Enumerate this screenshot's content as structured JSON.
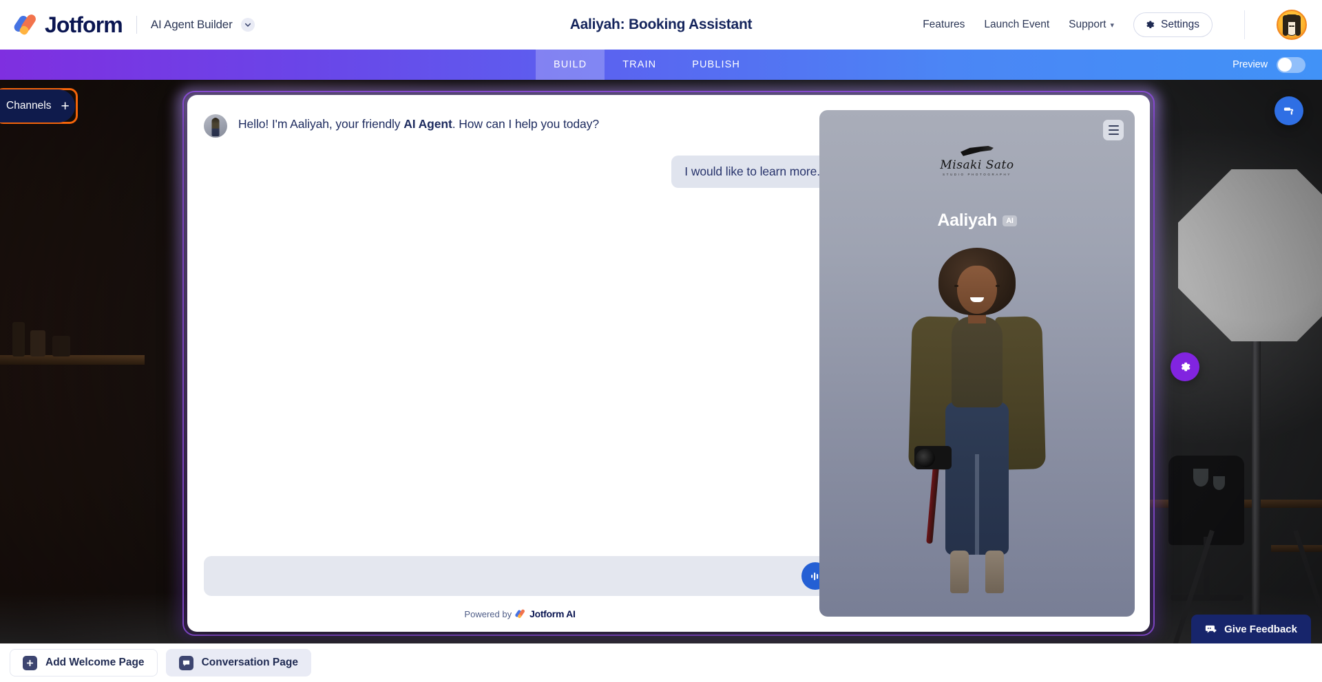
{
  "header": {
    "brand": "Jotform",
    "brand_logo_icon": "jotform-logo-icon",
    "product": "AI Agent Builder",
    "product_chevron_icon": "chevron-down-icon",
    "title": "Aaliyah: Booking Assistant",
    "nav_links": [
      {
        "label": "Features",
        "has_caret": false
      },
      {
        "label": "Launch Event",
        "has_caret": false
      },
      {
        "label": "Support",
        "has_caret": true
      }
    ],
    "support_caret_icon": "chevron-down-icon",
    "settings_label": "Settings",
    "settings_icon": "gear-icon",
    "avatar_icon": "user-avatar"
  },
  "navbar": {
    "tabs": [
      {
        "label": "BUILD",
        "active": true
      },
      {
        "label": "TRAIN",
        "active": false
      },
      {
        "label": "PUBLISH",
        "active": false
      }
    ],
    "preview_label": "Preview",
    "preview_on": false,
    "gradient_from": "#7f2fe0",
    "gradient_to": "#4192f7"
  },
  "channels": {
    "label": "Channels",
    "plus_icon": "plus-icon",
    "highlight_color": "#f4640a",
    "pill_color": "#0f1b4c"
  },
  "chat": {
    "agent_message": {
      "before": "Hello! I'm Aaliyah, your friendly ",
      "bold": "AI Agent",
      "after": ". How can I help you today?"
    },
    "user_message": "I would like to learn more.",
    "composer_placeholder": "",
    "mic_icon": "voice-waveform-icon",
    "powered_by_label": "Powered by",
    "powered_by_brand": "Jotform AI"
  },
  "hero": {
    "menu_icon": "hamburger-menu-icon",
    "logo_name": "Misaki Sato",
    "logo_sub": "STUDIO PHOTOGRAPHY",
    "agent_name": "Aaliyah",
    "ai_badge": "AI",
    "figure_icon": "agent-portrait"
  },
  "fabs": [
    {
      "name": "theme-button",
      "icon": "paint-roller-icon",
      "color": "#2f6fe4"
    },
    {
      "name": "agent-settings-button",
      "icon": "gear-icon",
      "color": "#8124e0"
    }
  ],
  "bottombar": {
    "add_welcome_page": "Add Welcome Page",
    "add_welcome_icon": "plus-square-icon",
    "conversation_page": "Conversation Page",
    "conversation_icon": "chat-bubble-icon"
  },
  "feedback": {
    "label": "Give Feedback",
    "icon": "feedback-icon"
  }
}
